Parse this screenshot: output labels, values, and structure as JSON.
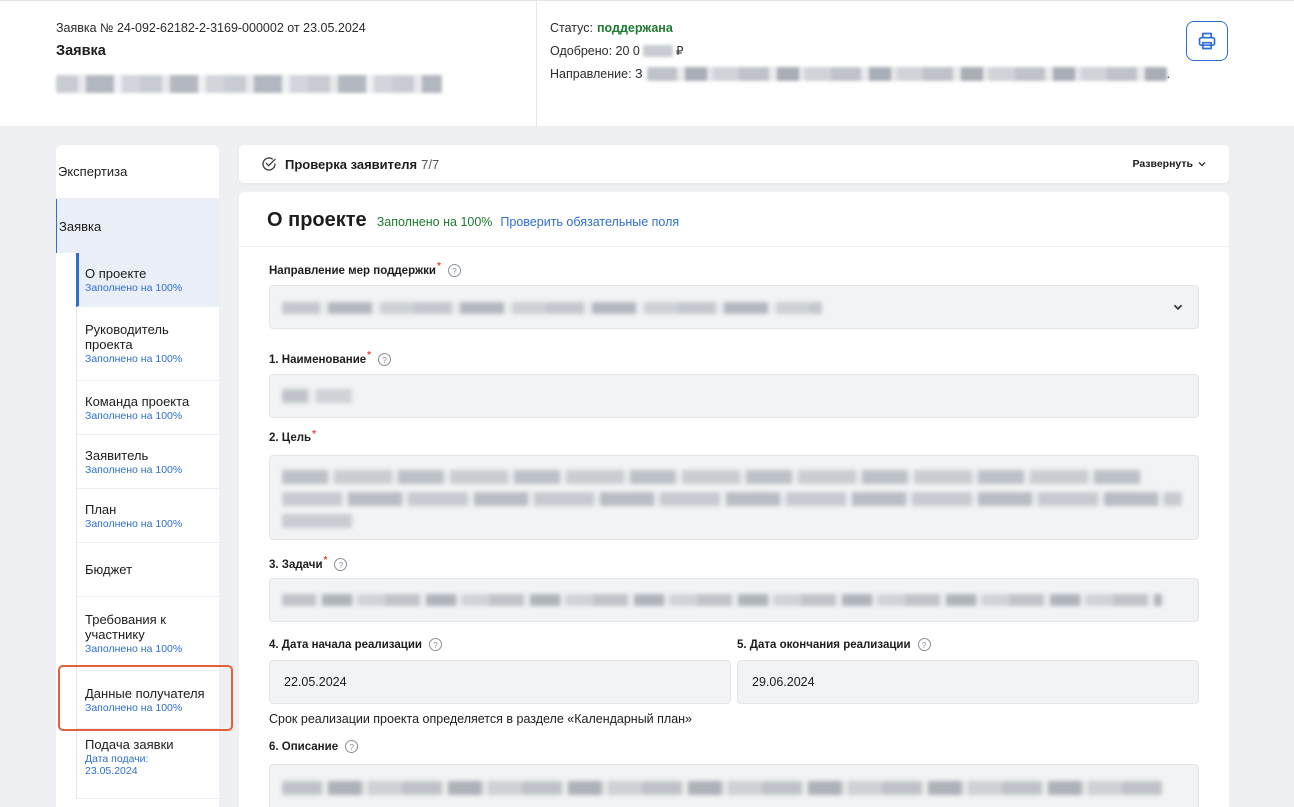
{
  "header": {
    "application_number": "Заявка № 24-092-62182-2-3169-000002 от 23.05.2024",
    "title": "Заявка",
    "status_label": "Статус:",
    "status_value": "поддержана",
    "approved_label": "Одобрено: 20 0",
    "approved_currency": "₽",
    "direction_label": "Направление: З",
    "direction_end": ".",
    "print_icon": "printer-icon"
  },
  "sidebar": {
    "expertise": "Экспертиза",
    "application": "Заявка",
    "items": [
      {
        "label": "О проекте",
        "status": "Заполнено на 100%"
      },
      {
        "label": "Руководитель проекта",
        "status": "Заполнено на 100%"
      },
      {
        "label": "Команда проекта",
        "status": "Заполнено на 100%"
      },
      {
        "label": "Заявитель",
        "status": "Заполнено на 100%"
      },
      {
        "label": "План",
        "status": "Заполнено на 100%"
      },
      {
        "label": "Бюджет",
        "status": ""
      },
      {
        "label": "Требования к участнику",
        "status": "Заполнено на 100%"
      },
      {
        "label": "Данные получателя",
        "status": "Заполнено на 100%"
      },
      {
        "label": "Подача заявки",
        "status": "Дата подачи: 23.05.2024"
      }
    ]
  },
  "check": {
    "title": "Проверка заявителя",
    "count": "7/7",
    "expand": "Развернуть"
  },
  "panel": {
    "title": "О проекте",
    "filled": "Заполнено на 100%",
    "check_required": "Проверить обязательные поля"
  },
  "fields": {
    "direction": "Направление мер поддержки",
    "name": "1. Наименование",
    "goal": "2. Цель",
    "tasks": "3. Задачи",
    "start_date_label": "4. Дата начала реализации",
    "end_date_label": "5. Дата окончания реализации",
    "start_date": "22.05.2024",
    "end_date": "29.06.2024",
    "period_note": "Срок реализации проекта определяется в разделе «Календарный план»",
    "description": "6. Описание"
  },
  "colors": {
    "accent": "#2d6ed0",
    "success": "#1e7b2f",
    "required": "#e0473a",
    "highlight": "#e0613a"
  }
}
